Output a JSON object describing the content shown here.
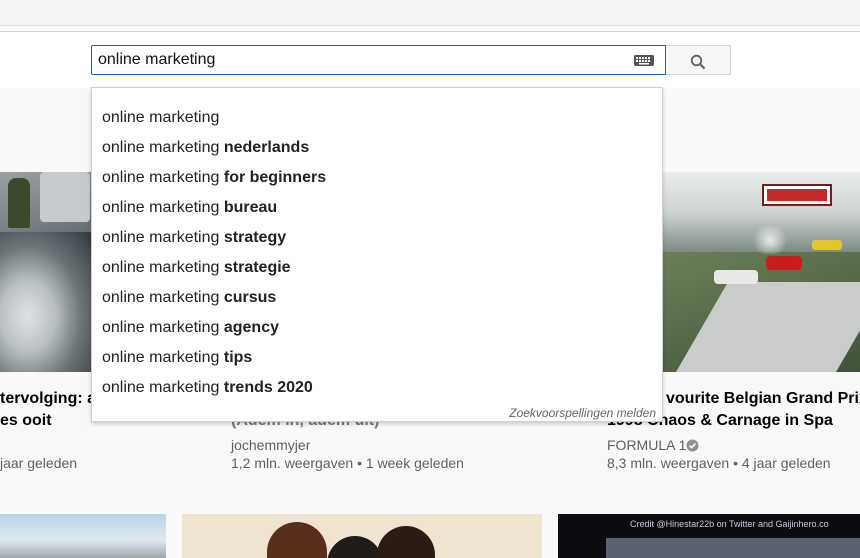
{
  "search": {
    "query": "online marketing",
    "keyboard_icon": "keyboard-icon",
    "search_icon": "search-icon"
  },
  "suggestions": [
    {
      "prefix": "online marketing",
      "suffix": ""
    },
    {
      "prefix": "online marketing",
      "suffix": "nederlands"
    },
    {
      "prefix": "online marketing",
      "suffix": "for beginners"
    },
    {
      "prefix": "online marketing",
      "suffix": "bureau"
    },
    {
      "prefix": "online marketing",
      "suffix": "strategy"
    },
    {
      "prefix": "online marketing",
      "suffix": "strategie"
    },
    {
      "prefix": "online marketing",
      "suffix": "cursus"
    },
    {
      "prefix": "online marketing",
      "suffix": "agency"
    },
    {
      "prefix": "online marketing",
      "suffix": "tips"
    },
    {
      "prefix": "online marketing",
      "suffix": "trends 2020"
    }
  ],
  "report_label": "Zoekvoorspellingen melden",
  "videos": [
    {
      "title_line1": "tervolging: ag",
      "title_line2": "es ooit",
      "meta": "jaar geleden"
    },
    {
      "title_line2": "(Adem in, adem uit)",
      "channel": "jochemmyjer",
      "meta": "1,2 mln. weergaven • 1 week geleden"
    },
    {
      "title_line1": "vourite Belgian Grand Prix -",
      "title_line2": "1998 Chaos & Carnage in Spa",
      "channel": "FORMULA 1",
      "verified_icon": "verified-check-icon",
      "meta": "8,3 mln. weergaven • 4 jaar geleden"
    }
  ],
  "watermark": "Credit @Hinestar22b on Twitter and Gaijinhero.co"
}
